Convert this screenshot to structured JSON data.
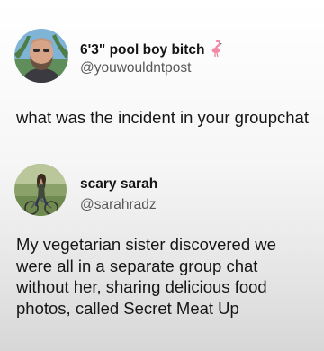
{
  "tweets": [
    {
      "display_name": "6'3\" pool boy bitch",
      "name_emoji": "flamingo-emoji",
      "handle": "@youwouldntpost",
      "text": "what was the incident in your groupchat"
    },
    {
      "display_name": "scary sarah",
      "handle": "@sarahradz_",
      "text": "My vegetarian sister discovered we were all in a separate group chat without her, sharing delicious food photos, called Secret Meat Up"
    }
  ],
  "colors": {
    "text": "#141414",
    "handle": "#575757",
    "flamingo": "#f08aa8"
  }
}
